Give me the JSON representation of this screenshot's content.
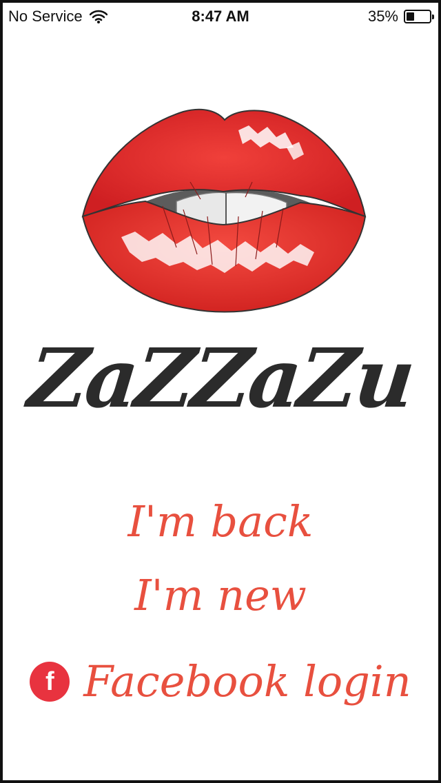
{
  "status_bar": {
    "carrier": "No Service",
    "time": "8:47 AM",
    "battery_percent": "35%",
    "battery_level": 0.35
  },
  "logo": {
    "text": "ZaZZaZu"
  },
  "actions": {
    "back_label": "I'm back",
    "new_label": "I'm new",
    "facebook_label": "Facebook login",
    "facebook_icon_glyph": "f"
  },
  "colors": {
    "accent": "#e8503f",
    "facebook_badge": "#e8333f",
    "logo_text": "#2b2b2b",
    "lips": "#e2262a"
  },
  "icons": {
    "wifi": "wifi-icon",
    "battery": "battery-icon",
    "lips": "lips-illustration",
    "facebook": "facebook-icon"
  }
}
